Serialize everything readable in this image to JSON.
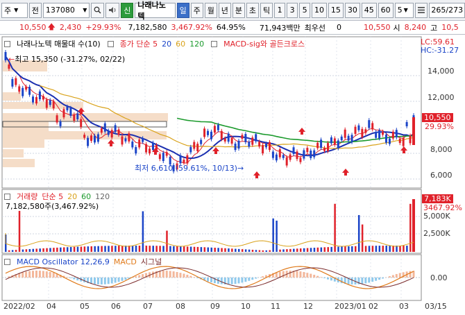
{
  "toolbar": {
    "market": "주",
    "code_label": "전",
    "code": "137080",
    "stock_name": "나래나노텍",
    "sin_label": "신",
    "period_buttons": [
      "일",
      "주",
      "월",
      "년",
      "분",
      "초",
      "틱"
    ],
    "minute_buttons": [
      "1",
      "3",
      "5",
      "10",
      "15",
      "30",
      "45",
      "60",
      "5"
    ],
    "count": "265",
    "total": "/273"
  },
  "quote": {
    "price": "10,550",
    "change": "2,430",
    "change_pct": "+29.93%",
    "volume": "7,182,580",
    "vol_pct": "3,467.92%",
    "ratio": "64.95%",
    "amount": "71,943백만",
    "best_label": "최우선",
    "best_val": "0",
    "open_price": "10,550",
    "open_label": "시",
    "high_val": "8,240",
    "high_label": "고",
    "high_price": "10,5"
  },
  "price_panel": {
    "title": "나래나노텍 매물대 수(10)",
    "ma_label": "종가 단순 5",
    "ma_periods": [
      "20",
      "60",
      "120"
    ],
    "signal_label": "MACD-sig와 골든크로스",
    "lc": "LC:59.61",
    "hc": "HC:-31.27",
    "high_annot": "최고 15,350 (-31.27%, 02/22)",
    "low_annot": "최저 6,610 (59.61%, 10/13)",
    "current_price_tag": "10,550",
    "current_pct_tag": "29.93%",
    "y_ticks": [
      "14,000",
      "12,000",
      "8,000",
      "6,000"
    ]
  },
  "volume_panel": {
    "title": "거래량",
    "ma_label": "단순 5",
    "ma_periods": [
      "20",
      "60",
      "120"
    ],
    "value_text": "7,182,580주(3,467.92%)",
    "tag_value": "7,183K",
    "tag_pct": "3467.92%",
    "y_ticks": [
      "5,000K",
      "2,500K"
    ]
  },
  "macd_panel": {
    "title": "MACD Oscillator 12,26,9",
    "macd_label": "MACD",
    "signal_label": "시그널",
    "y_tick": "0.00"
  },
  "x_axis": [
    "2022/02",
    "04",
    "05",
    "06",
    "07",
    "08",
    "09",
    "10",
    "11",
    "12",
    "2023/01",
    "02",
    "03",
    "03/15"
  ],
  "colors": {
    "up": "#e0212a",
    "down": "#1a44c8",
    "ma5": "#e0212a",
    "ma20": "#1a2fb0",
    "ma60": "#d9a21a",
    "ma120": "#1b9a2c",
    "volume_profile": "#f5ddc8"
  }
}
